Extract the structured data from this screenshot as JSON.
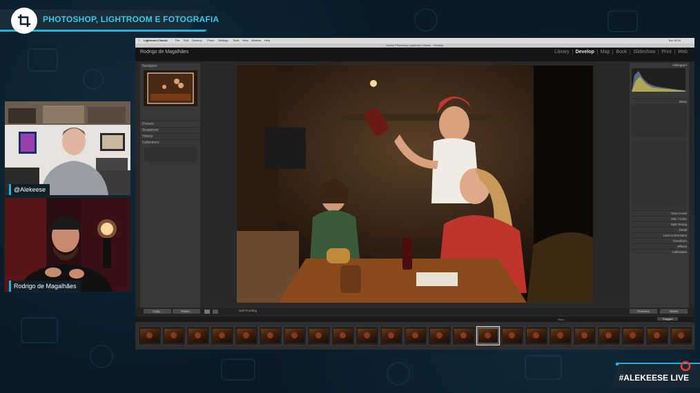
{
  "stream": {
    "banner_title": "PHOTOSHOP, LIGHTROOM E FOTOGRAFIA",
    "hashtag": "#ALEKEESE LIVE",
    "accent_color": "#1fb5d6",
    "logo_icon": "crop-icon"
  },
  "webcams": [
    {
      "label": "@Alekeese"
    },
    {
      "label": "Rodrigo de Magalhães"
    }
  ],
  "mac_menu": {
    "app": "Lightroom Classic",
    "items": [
      "File",
      "Edit",
      "Develop",
      "Photo",
      "Settings",
      "Tools",
      "View",
      "Window",
      "Help"
    ],
    "clock": "Tue 16:16"
  },
  "window_title": "Adobe Photoshop Lightroom Classic - Develop",
  "lightroom": {
    "identity_plate": "Rodrigo de Magalhães",
    "modules": [
      "Library",
      "Develop",
      "Map",
      "Book",
      "Slideshow",
      "Print",
      "Web"
    ],
    "active_module": "Develop",
    "left_panels": [
      "Navigator",
      "Presets",
      "Snapshots",
      "History",
      "Collections"
    ],
    "right_panels": [
      "Histogram",
      "Basic",
      "Tone Curve",
      "HSL / Color",
      "Split Toning",
      "Detail",
      "Lens Corrections",
      "Transform",
      "Effects",
      "Calibration"
    ],
    "copy_button": "Copy...",
    "paste_button": "Paste...",
    "soft_proofing": "Soft Proofing",
    "previous_button": "Previous",
    "reset_button": "Reset",
    "filter_label": "Filter :",
    "filter_value": "Flagged",
    "filmstrip_count": 24,
    "selected_frame": 14
  }
}
